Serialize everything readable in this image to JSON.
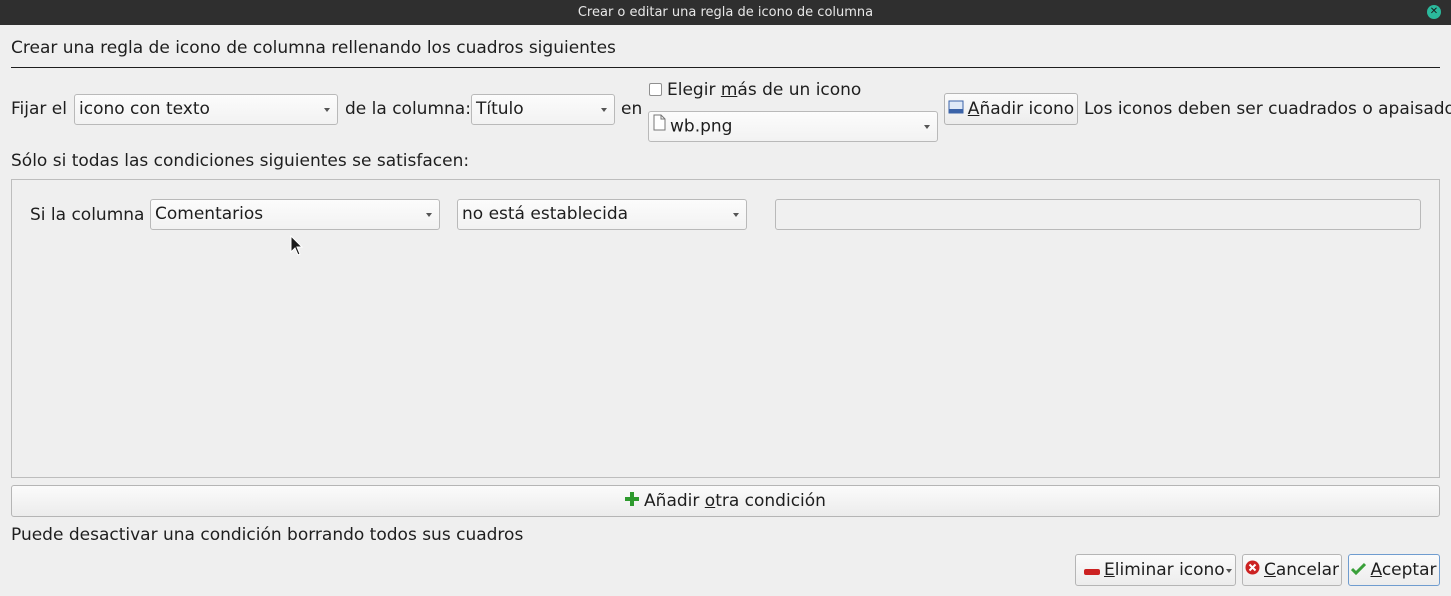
{
  "window": {
    "title": "Crear o editar una regla de icono de columna"
  },
  "heading": "Crear una regla de icono de columna rellenando los cuadros siguientes",
  "rule": {
    "set_label": "Fijar el",
    "kind_value": "icono con texto",
    "column_label": "de la columna:",
    "column_value": "Título",
    "in_label": "en",
    "multi_checkbox_label_pre": "Elegir ",
    "multi_checkbox_label_u": "m",
    "multi_checkbox_label_post": "ás de un icono",
    "multi_checked": false,
    "icon_value": "wb.png",
    "add_icon_u": "A",
    "add_icon_rest": "ñadir icono",
    "hint": "Los iconos deben ser cuadrados o apaisados"
  },
  "conditions_label": "Sólo si todas las condiciones siguientes se satisfacen:",
  "condition": {
    "if_label": "Si la columna",
    "column_value": "Comentarios",
    "operator_value": "no está establecida",
    "value": ""
  },
  "add_condition": {
    "pre": "Añadir ",
    "u": "o",
    "post": "tra condición"
  },
  "footer_hint": "Puede desactivar una condición borrando todos sus cuadros",
  "buttons": {
    "remove_u": "E",
    "remove_rest": "liminar icono",
    "cancel_u": "C",
    "cancel_rest": "ancelar",
    "accept_u": "A",
    "accept_rest": "ceptar"
  },
  "colors": {
    "titlebar": "#2f2f2f",
    "close": "#2bb99c",
    "plus": "#2e9a2e",
    "remove": "#cc2222",
    "cancel": "#cc2222",
    "accept": "#3aa03a"
  }
}
